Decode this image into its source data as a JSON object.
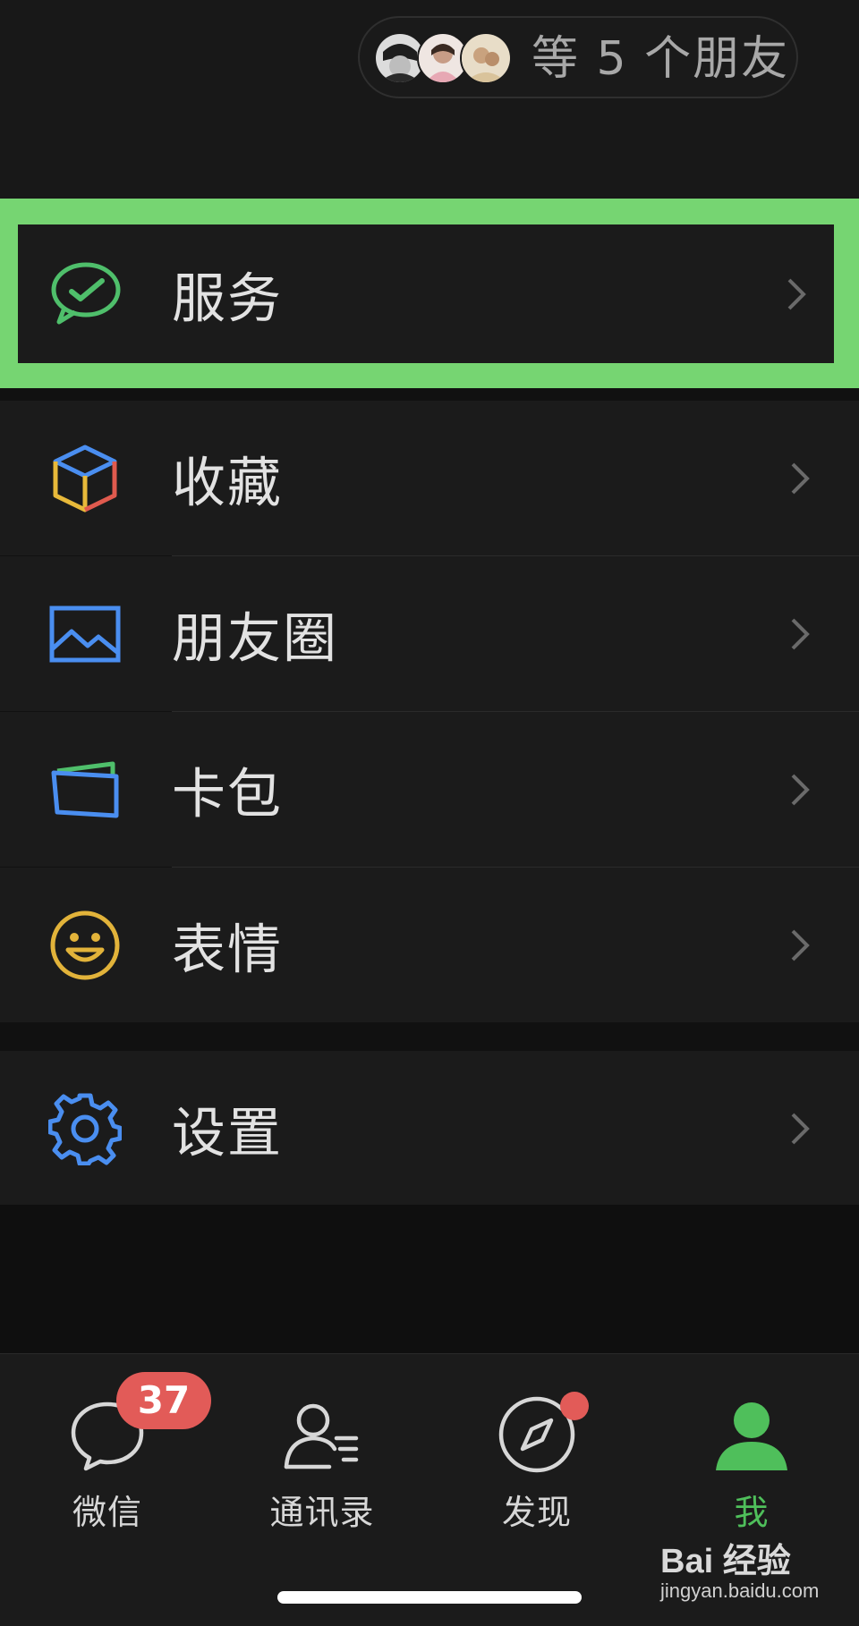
{
  "header": {
    "friends_label": "等 5 个朋友",
    "avatars": [
      "avatar-1",
      "avatar-2",
      "avatar-3"
    ]
  },
  "menu": {
    "service": {
      "label": "服务",
      "icon": "wechat-pay-icon"
    },
    "group1": [
      {
        "label": "收藏",
        "icon": "favorites-cube-icon"
      },
      {
        "label": "朋友圈",
        "icon": "moments-picture-icon"
      },
      {
        "label": "卡包",
        "icon": "card-wallet-icon"
      },
      {
        "label": "表情",
        "icon": "smiley-icon"
      }
    ],
    "settings": {
      "label": "设置",
      "icon": "gear-icon"
    }
  },
  "tabbar": {
    "tabs": [
      {
        "label": "微信",
        "badge": "37"
      },
      {
        "label": "通讯录"
      },
      {
        "label": "发现"
      },
      {
        "label": "我"
      }
    ]
  },
  "watermark": {
    "brand": "Bai 经验",
    "url": "jingyan.baidu.com"
  },
  "colors": {
    "highlight": "#76d572",
    "accent_green": "#4fbf5b",
    "badge_red": "#e25b58",
    "background": "#1b1b1b"
  }
}
